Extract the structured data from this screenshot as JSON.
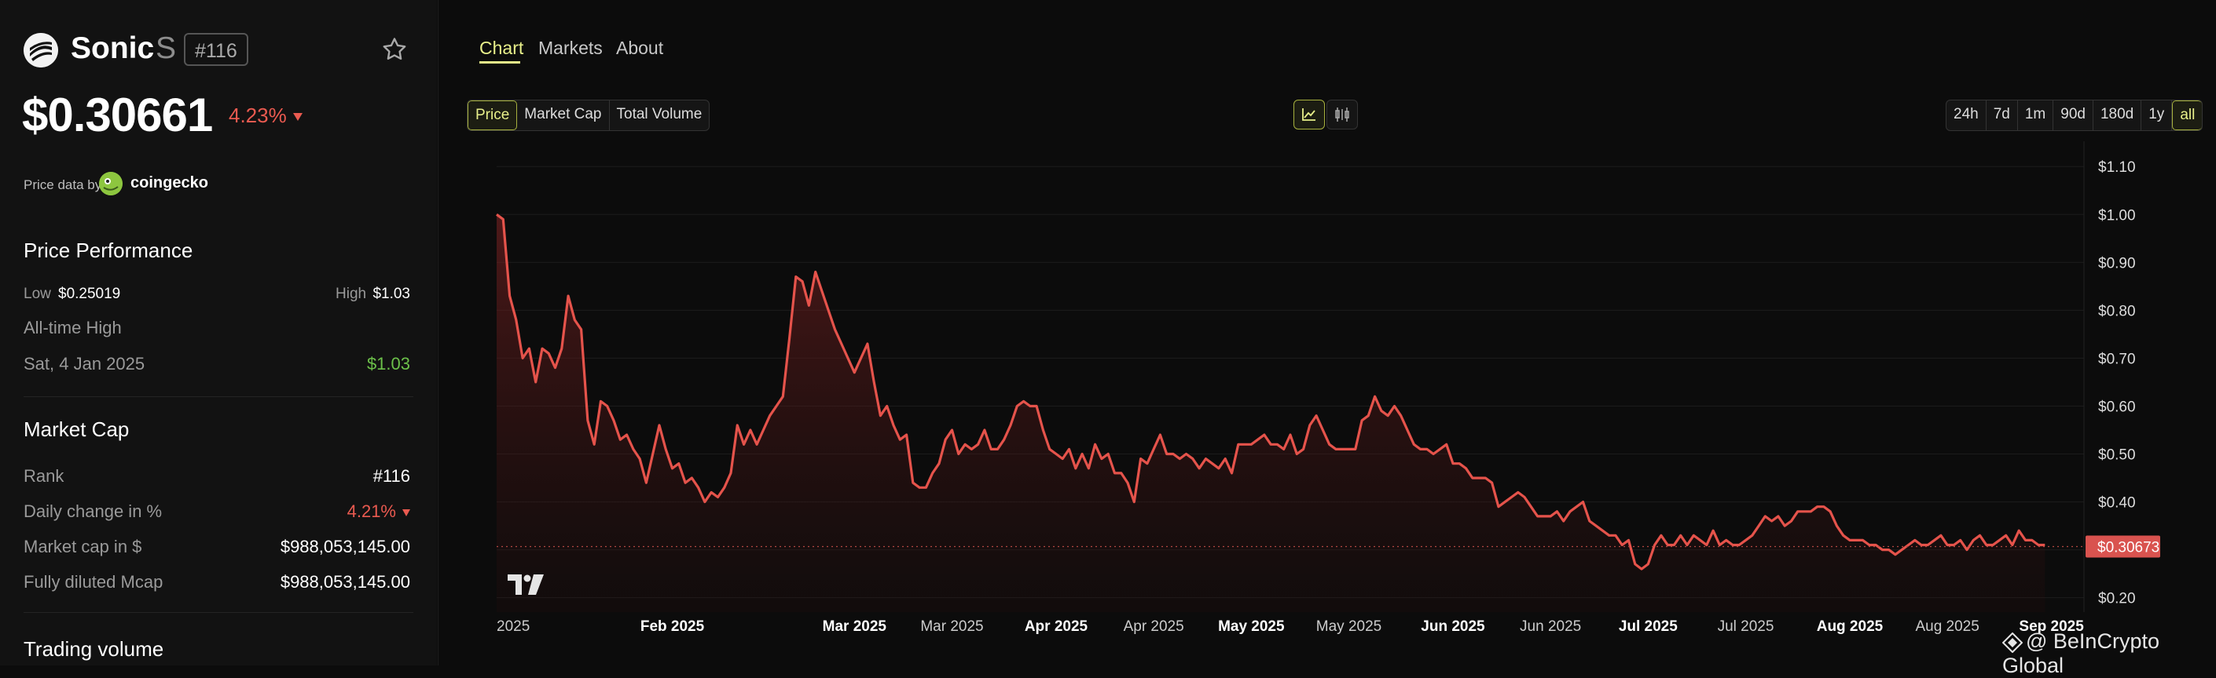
{
  "coin": {
    "name": "Sonic",
    "symbol": "S",
    "rank_badge": "#116",
    "price": "$0.30661",
    "change": "4.23%",
    "change_dir": "down",
    "price_data_by": "Price data by",
    "provider": "coingecko"
  },
  "performance": {
    "title": "Price Performance",
    "low_label": "Low",
    "low_value": "$0.25019",
    "high_label": "High",
    "high_value": "$1.03",
    "ath_label": "All-time High",
    "ath_date": "Sat, 4 Jan 2025",
    "ath_value": "$1.03"
  },
  "market_cap": {
    "title": "Market Cap",
    "rows": [
      {
        "label": "Rank",
        "value": "#116"
      },
      {
        "label": "Daily change in %",
        "value": "4.21%"
      },
      {
        "label": "Market cap in $",
        "value": "$988,053,145.00"
      },
      {
        "label": "Fully diluted Mcap",
        "value": "$988,053,145.00"
      }
    ]
  },
  "trading_volume": {
    "title": "Trading volume"
  },
  "tabs": [
    "Chart",
    "Markets",
    "About"
  ],
  "active_tab": "Chart",
  "metrics": [
    "Price",
    "Market Cap",
    "Total Volume"
  ],
  "active_metric": "Price",
  "ranges": [
    "24h",
    "7d",
    "1m",
    "90d",
    "180d",
    "1y",
    "all"
  ],
  "active_range": "all",
  "chart_icons": {
    "line": "line-chart-icon",
    "candle": "candlestick-icon"
  },
  "watermark": "@ BeInCrypto Global",
  "colors": {
    "accent": "#e8f08a",
    "down": "#ea5a50",
    "up": "#6cc04a",
    "line": "#e5534b"
  },
  "chart_data": {
    "type": "area",
    "ylim": [
      0.17,
      1.12
    ],
    "yticks": [
      "$1.10",
      "$1.00",
      "$0.90",
      "$0.80",
      "$0.70",
      "$0.60",
      "$0.50",
      "$0.40",
      "$0.30",
      "$0.20"
    ],
    "ytick_values": [
      1.1,
      1.0,
      0.9,
      0.8,
      0.7,
      0.6,
      0.5,
      0.4,
      0.3,
      0.2
    ],
    "xticks": [
      {
        "label": "2025",
        "x": 0,
        "bold": false
      },
      {
        "label": "Feb 2025",
        "x": 27,
        "bold": true
      },
      {
        "label": "Mar 2025",
        "x": 55,
        "bold": true
      },
      {
        "label": "Mar 2025",
        "x": 70,
        "bold": false
      },
      {
        "label": "Apr 2025",
        "x": 86,
        "bold": true
      },
      {
        "label": "Apr 2025",
        "x": 101,
        "bold": false
      },
      {
        "label": "May 2025",
        "x": 116,
        "bold": true
      },
      {
        "label": "May 2025",
        "x": 131,
        "bold": false
      },
      {
        "label": "Jun 2025",
        "x": 147,
        "bold": true
      },
      {
        "label": "Jun 2025",
        "x": 162,
        "bold": false
      },
      {
        "label": "Jul 2025",
        "x": 177,
        "bold": true
      },
      {
        "label": "Jul 2025",
        "x": 192,
        "bold": false
      },
      {
        "label": "Aug 2025",
        "x": 208,
        "bold": true
      },
      {
        "label": "Aug 2025",
        "x": 223,
        "bold": false
      },
      {
        "label": "Sep 2025",
        "x": 239,
        "bold": true
      }
    ],
    "last_price_label": "$0.30673",
    "last_price": 0.30673,
    "x_max": 244,
    "values": [
      1.0,
      0.99,
      0.83,
      0.78,
      0.7,
      0.72,
      0.65,
      0.72,
      0.71,
      0.68,
      0.72,
      0.83,
      0.78,
      0.76,
      0.57,
      0.52,
      0.61,
      0.6,
      0.57,
      0.53,
      0.54,
      0.51,
      0.49,
      0.44,
      0.5,
      0.56,
      0.51,
      0.47,
      0.48,
      0.44,
      0.45,
      0.43,
      0.4,
      0.42,
      0.41,
      0.43,
      0.46,
      0.56,
      0.52,
      0.55,
      0.52,
      0.55,
      0.58,
      0.6,
      0.62,
      0.74,
      0.87,
      0.86,
      0.81,
      0.88,
      0.84,
      0.8,
      0.76,
      0.73,
      0.7,
      0.67,
      0.7,
      0.73,
      0.65,
      0.58,
      0.6,
      0.56,
      0.53,
      0.54,
      0.44,
      0.43,
      0.43,
      0.46,
      0.48,
      0.53,
      0.55,
      0.5,
      0.52,
      0.51,
      0.52,
      0.55,
      0.51,
      0.51,
      0.53,
      0.56,
      0.6,
      0.61,
      0.6,
      0.6,
      0.55,
      0.51,
      0.5,
      0.49,
      0.51,
      0.47,
      0.5,
      0.47,
      0.52,
      0.49,
      0.5,
      0.46,
      0.46,
      0.44,
      0.4,
      0.49,
      0.48,
      0.51,
      0.54,
      0.5,
      0.5,
      0.49,
      0.5,
      0.49,
      0.47,
      0.49,
      0.48,
      0.47,
      0.49,
      0.46,
      0.52,
      0.52,
      0.52,
      0.53,
      0.54,
      0.52,
      0.52,
      0.51,
      0.54,
      0.5,
      0.51,
      0.56,
      0.58,
      0.55,
      0.52,
      0.51,
      0.51,
      0.51,
      0.51,
      0.57,
      0.58,
      0.62,
      0.59,
      0.58,
      0.6,
      0.58,
      0.55,
      0.52,
      0.51,
      0.51,
      0.5,
      0.51,
      0.52,
      0.48,
      0.48,
      0.47,
      0.45,
      0.45,
      0.45,
      0.44,
      0.39,
      0.4,
      0.41,
      0.42,
      0.41,
      0.39,
      0.37,
      0.37,
      0.37,
      0.38,
      0.36,
      0.38,
      0.39,
      0.4,
      0.36,
      0.35,
      0.34,
      0.33,
      0.33,
      0.31,
      0.32,
      0.27,
      0.26,
      0.27,
      0.31,
      0.33,
      0.31,
      0.31,
      0.33,
      0.31,
      0.33,
      0.32,
      0.31,
      0.34,
      0.31,
      0.32,
      0.31,
      0.31,
      0.32,
      0.33,
      0.35,
      0.37,
      0.36,
      0.37,
      0.35,
      0.36,
      0.38,
      0.38,
      0.38,
      0.39,
      0.39,
      0.38,
      0.35,
      0.33,
      0.32,
      0.32,
      0.32,
      0.31,
      0.31,
      0.3,
      0.3,
      0.29,
      0.3,
      0.31,
      0.32,
      0.31,
      0.31,
      0.32,
      0.33,
      0.31,
      0.31,
      0.32,
      0.3,
      0.32,
      0.33,
      0.31,
      0.31,
      0.32,
      0.33,
      0.31,
      0.34,
      0.32,
      0.32,
      0.31,
      0.31
    ]
  }
}
